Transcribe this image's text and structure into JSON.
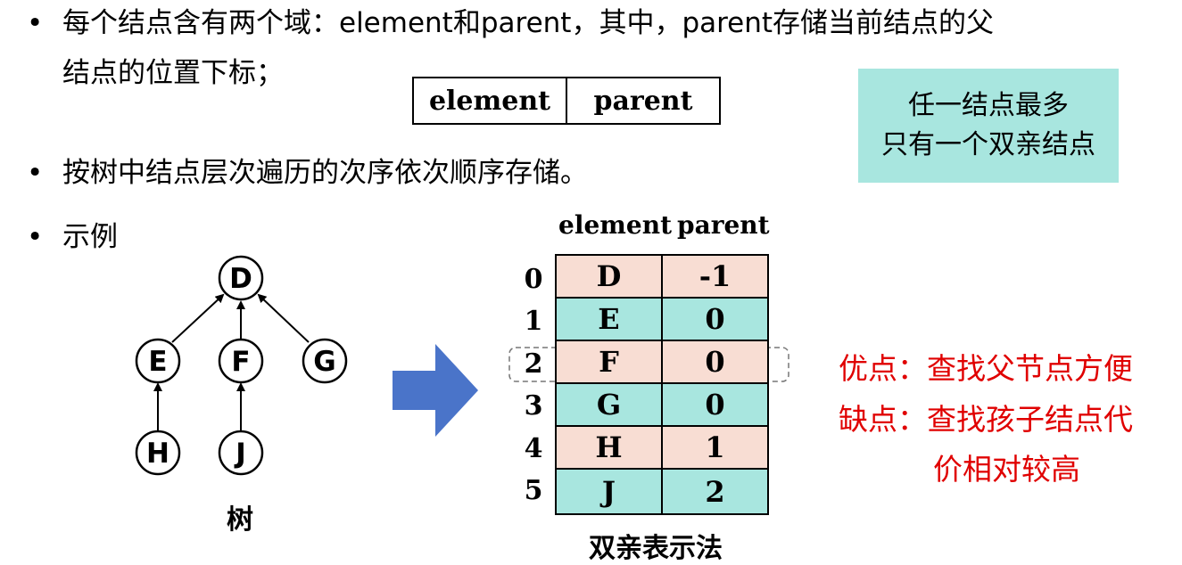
{
  "bullets": [
    {
      "dot": "•",
      "line1": "每个结点含有两个域：element和parent，其中，parent存储当前结点的父",
      "line2": "结点的位置下标；"
    },
    {
      "dot": "•",
      "text": "按树中结点层次遍历的次序依次顺序存储。"
    },
    {
      "dot": "•",
      "text": "示例"
    }
  ],
  "node_struct": {
    "element": "element",
    "parent": "parent"
  },
  "note": {
    "line1": "任一结点最多",
    "line2": "只有一个双亲结点"
  },
  "tree": {
    "nodes": [
      "D",
      "E",
      "F",
      "G",
      "H",
      "J"
    ],
    "caption": "树"
  },
  "table": {
    "col_element": "element",
    "col_parent": "parent",
    "rows": [
      {
        "index": "0",
        "element": "D",
        "parent": "-1"
      },
      {
        "index": "1",
        "element": "E",
        "parent": "0"
      },
      {
        "index": "2",
        "element": "F",
        "parent": "0"
      },
      {
        "index": "3",
        "element": "G",
        "parent": "0"
      },
      {
        "index": "4",
        "element": "H",
        "parent": "1"
      },
      {
        "index": "5",
        "element": "J",
        "parent": "2"
      }
    ],
    "caption": "双亲表示法"
  },
  "pros_cons": {
    "pro": "优点：查找父节点方便",
    "con_line1": "缺点：查找孩子结点代",
    "con_line2": "价相对较高"
  },
  "colors": {
    "pink": "#f8ddd3",
    "teal": "#a8e6df",
    "arrow": "#4a74c9",
    "red": "#e00000"
  }
}
